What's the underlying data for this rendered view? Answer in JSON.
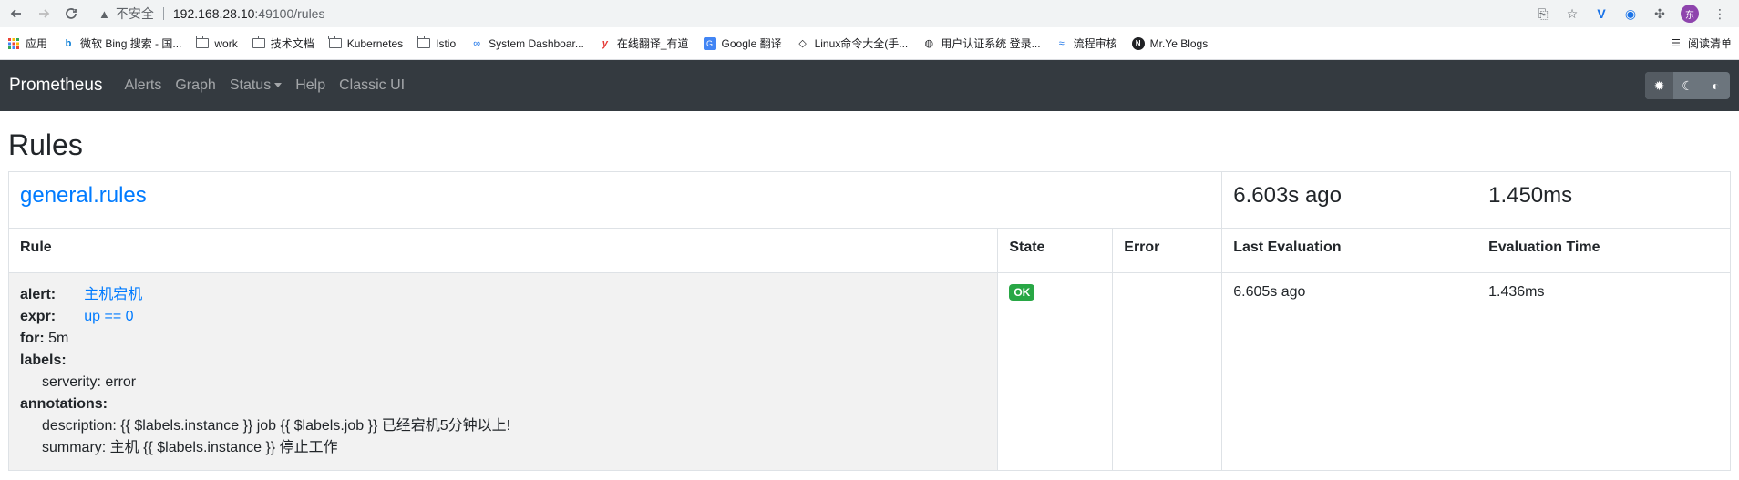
{
  "browser": {
    "insecure_label": "不安全",
    "url_host": "192.168.28.10",
    "url_path": ":49100/rules",
    "avatar_letter": "东"
  },
  "bookmarks": [
    {
      "label": "应用",
      "icon": "apps-grid-icon"
    },
    {
      "label": "微软 Bing 搜索 - 国...",
      "icon": "bing-icon"
    },
    {
      "label": "work",
      "icon": "folder-icon"
    },
    {
      "label": "技术文档",
      "icon": "folder-icon"
    },
    {
      "label": "Kubernetes",
      "icon": "folder-icon"
    },
    {
      "label": "Istio",
      "icon": "folder-icon"
    },
    {
      "label": "System Dashboar...",
      "icon": "link-icon"
    },
    {
      "label": "在线翻译_有道",
      "icon": "youdao-icon"
    },
    {
      "label": "Google 翻译",
      "icon": "google-translate-icon"
    },
    {
      "label": "Linux命令大全(手...",
      "icon": "linux-icon"
    },
    {
      "label": "用户认证系统 登录...",
      "icon": "globe-icon"
    },
    {
      "label": "流程审核",
      "icon": "wave-icon"
    },
    {
      "label": "Mr.Ye Blogs",
      "icon": "blog-icon"
    }
  ],
  "reading_list": "阅读清单",
  "navbar": {
    "brand": "Prometheus",
    "links": [
      "Alerts",
      "Graph",
      "Status",
      "Help",
      "Classic UI"
    ]
  },
  "page": {
    "title": "Rules"
  },
  "group": {
    "name": "general.rules",
    "last_evaluation": "6.603s ago",
    "evaluation_time": "1.450ms"
  },
  "columns": [
    "Rule",
    "State",
    "Error",
    "Last Evaluation",
    "Evaluation Time"
  ],
  "rule": {
    "alert_key": "alert:",
    "alert_value": "主机宕机",
    "expr_key": "expr:",
    "expr_value": "up == 0",
    "for_key": "for:",
    "for_value": "5m",
    "labels_key": "labels:",
    "label_line": "serverity: error",
    "annotations_key": "annotations:",
    "annotation_description": "description: {{ $labels.instance }} job {{ $labels.job }} 已经宕机5分钟以上!",
    "annotation_summary": "summary: 主机 {{ $labels.instance }} 停止工作",
    "state": "OK",
    "error": "",
    "last_evaluation": "6.605s ago",
    "evaluation_time": "1.436ms"
  },
  "colors": {
    "navbar_bg": "#343a40",
    "link": "#007bff",
    "ok_badge": "#28a745"
  }
}
